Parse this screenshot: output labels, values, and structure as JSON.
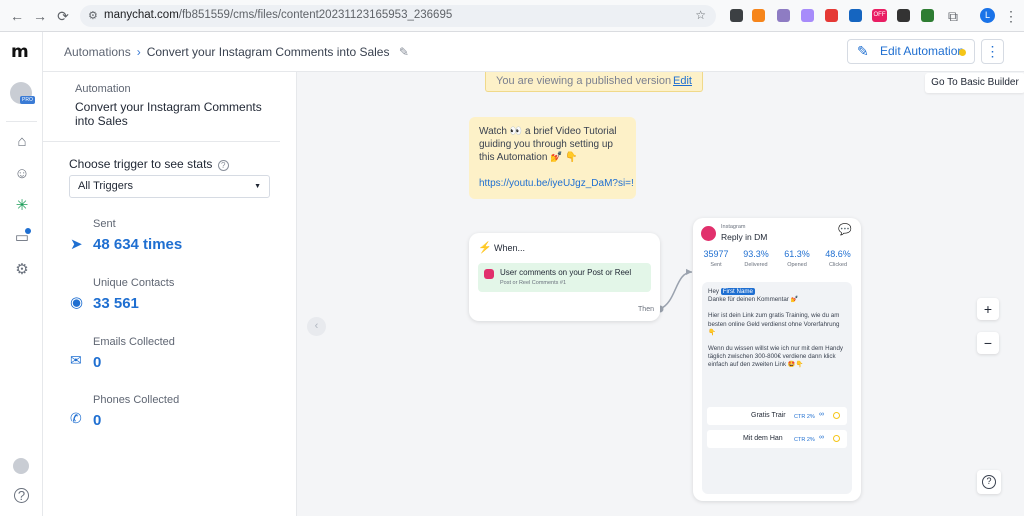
{
  "browser": {
    "url_domain": "manychat.com",
    "url_path": "/fb851559/cms/files/content20231123165953_236695",
    "badge_off": "OFF",
    "profile_initial": "L"
  },
  "rail": {
    "pro_badge": "PRO"
  },
  "header": {
    "crumb_root": "Automations",
    "crumb_current": "Convert your Instagram Comments into Sales",
    "edit_label": "Edit Automation",
    "basic_builder": "Go To Basic Builder"
  },
  "panel": {
    "section_label": "Automation",
    "title": "Convert your Instagram Comments into Sales",
    "trigger_label": "Choose trigger to see stats",
    "trigger_value": "All Triggers",
    "stats": [
      {
        "label": "Sent",
        "value": "48 634 times"
      },
      {
        "label": "Unique Contacts",
        "value": "33 561"
      },
      {
        "label": "Emails Collected",
        "value": "0"
      },
      {
        "label": "Phones Collected",
        "value": "0"
      }
    ]
  },
  "canvas": {
    "banner_text": "You are viewing a published version",
    "banner_link": "Edit",
    "note_text": "Watch 👀 a brief Video Tutorial guiding you through setting up this Automation 💅 👇",
    "note_link": "https://youtu.be/iyeUJgz_DaM?si=!",
    "trigger_card": {
      "title": "When...",
      "trigger_text": "User comments on your Post or Reel",
      "trigger_sub": "Post or Reel Comments #1",
      "then_label": "Then"
    },
    "dm_card": {
      "platform": "Instagram",
      "title": "Reply in DM",
      "stats": [
        {
          "value": "35977",
          "label": "Sent"
        },
        {
          "value": "93.3%",
          "label": "Delivered"
        },
        {
          "value": "61.3%",
          "label": "Opened"
        },
        {
          "value": "48.6%",
          "label": "Clicked"
        }
      ],
      "msg_hey": "Hey",
      "msg_first_name": "First Name",
      "msg_line1": "Danke für deinen Kommentar 💅",
      "msg_line2": "Hier ist dein Link zum gratis Training, wie du am besten online Geld verdienst ohne Vorerfahrung 👇",
      "msg_line3": "Wenn du wissen willst wie ich nur mit dem Handy täglich zwischen 300-800€ verdiene dann klick einfach auf den zweiten Link 🤩👇",
      "buttons": [
        {
          "label": "Gratis Trair",
          "ctr": "CTR 2%"
        },
        {
          "label": "Mit dem Han",
          "ctr": "CTR 2%"
        }
      ]
    },
    "zoom_in": "+",
    "zoom_out": "−",
    "help": "?"
  },
  "colors": {
    "accent": "#1f6fd1",
    "instagram": "#e1306c",
    "banner_bg": "#fdf1c8",
    "trigger_bg": "#e3f6e8"
  }
}
